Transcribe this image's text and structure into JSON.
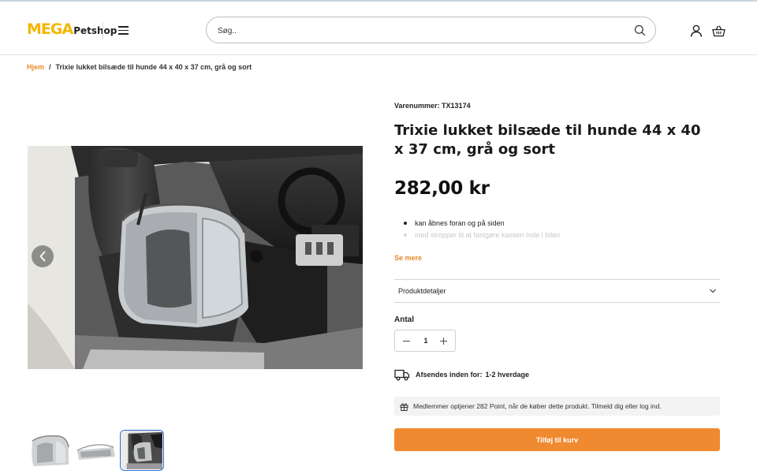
{
  "header": {
    "logo_mega": "MEGA",
    "logo_petshop": "Petshop",
    "search_placeholder": "Søg..",
    "icons": [
      "menu-icon",
      "search-icon",
      "user-icon",
      "basket-icon"
    ]
  },
  "breadcrumb": {
    "home": "Hjem",
    "separator": "/",
    "current": "Trixie lukket bilsæde til hunde 44 x 40 x 37 cm, grå og sort"
  },
  "gallery": {
    "thumbnails": [
      "thumbnail-1",
      "thumbnail-2",
      "thumbnail-3"
    ],
    "active_thumbnail": 3
  },
  "product": {
    "sku_label": "Varenummer:",
    "sku": "TX13174",
    "title": "Trixie lukket bilsæde til hunde 44 x 40 x 37 cm, grå og sort",
    "price": "282,00 kr",
    "features": [
      "kan åbnes foran og på siden",
      "med stropper til at fastgøre kassen inde i bilen"
    ],
    "see_more": "Se mere",
    "details_label": "Produktdetaljer",
    "quantity_label": "Antal",
    "quantity": "1",
    "shipping_label": "Afsendes inden for:",
    "shipping_value": "1-2 hverdage",
    "points_text": "Medlemmer optjener 282 Point, når de køber dette produkt. Tilmeld dig eller log ind.",
    "add_to_cart": "Tilføj til kurv"
  },
  "colors": {
    "accent": "#f08a30",
    "link": "#e8892d",
    "logo_yellow": "#f2b705",
    "thumb_active_border": "#2f6fd6"
  }
}
